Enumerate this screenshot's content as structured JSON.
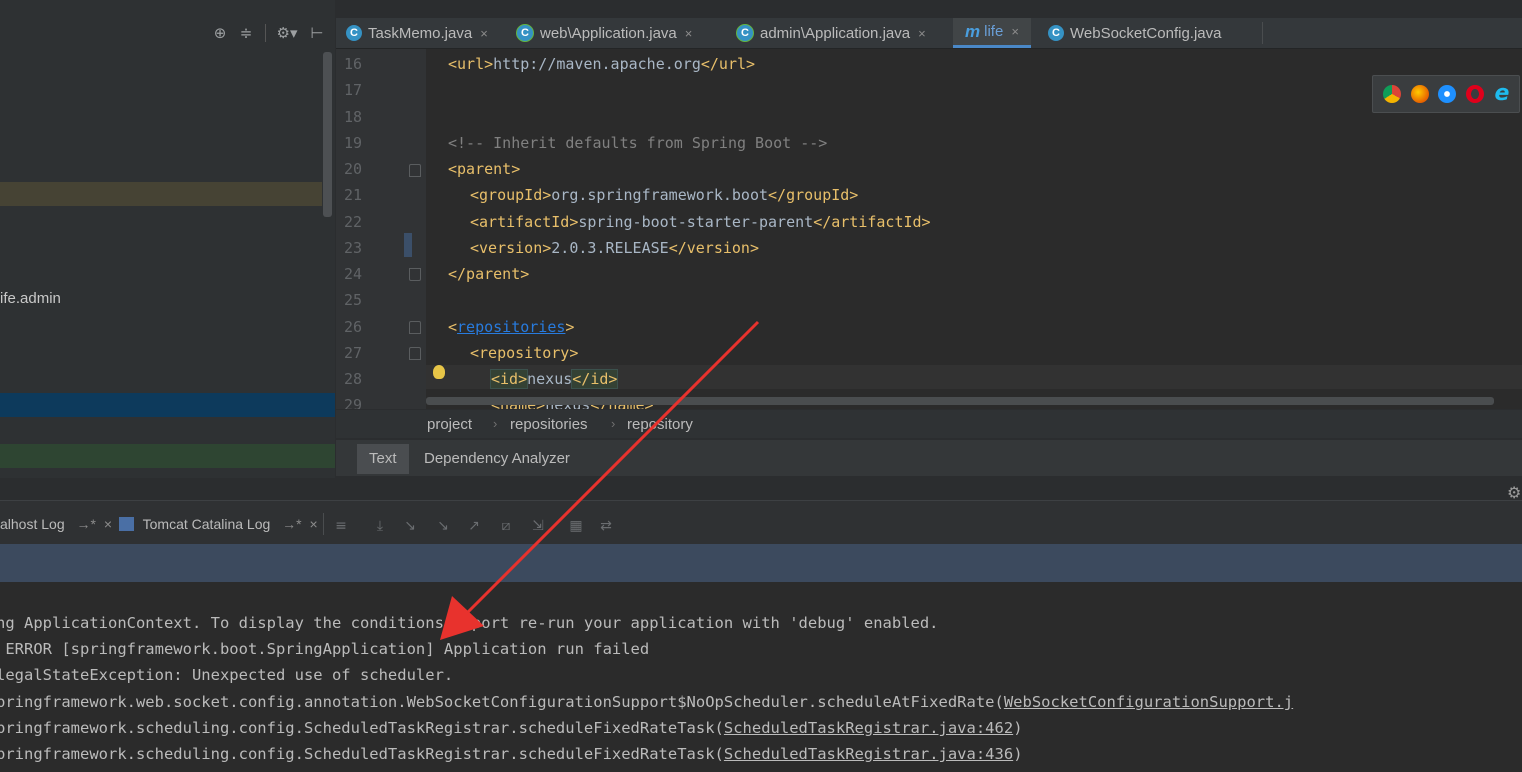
{
  "editor_tabs": [
    {
      "label": "TaskMemo.java",
      "icon": "class-icon",
      "close": "×"
    },
    {
      "label": "web\\Application.java",
      "icon": "app-class-icon",
      "close": "×"
    },
    {
      "label": "admin\\Application.java",
      "icon": "app-class-icon",
      "close": "×"
    },
    {
      "label": "life",
      "icon": "maven-icon",
      "close": "×",
      "active": true
    },
    {
      "label": "WebSocketConfig.java",
      "icon": "class-icon",
      "close": ""
    }
  ],
  "project_panel": {
    "visible_label": "ife.admin"
  },
  "code": {
    "line_numbers": [
      "16",
      "17",
      "18",
      "19",
      "20",
      "21",
      "22",
      "23",
      "24",
      "25",
      "26",
      "27",
      "28",
      "29"
    ],
    "l16_open": "<url>",
    "l16_text": "http://maven.apache.org",
    "l16_close": "</url>",
    "l19_comment": "<!-- Inherit defaults from Spring Boot -->",
    "l20_tag": "<parent>",
    "l21_open": "<groupId>",
    "l21_text": "org.springframework.boot",
    "l21_close": "</groupId>",
    "l22_open": "<artifactId>",
    "l22_text": "spring-boot-starter-parent",
    "l22_close": "</artifactId>",
    "l23_open": "<version>",
    "l23_text": "2.0.3.RELEASE",
    "l23_close": "</version>",
    "l24_tag": "</parent>",
    "l26_lt": "<",
    "l26_name": "repositories",
    "l26_gt": ">",
    "l27_tag": "<repository>",
    "l28_open": "<id>",
    "l28_text": "nexus",
    "l28_close": "</id>",
    "l29_open": "<name>",
    "l29_text": "nexus",
    "l29_close": "</name>"
  },
  "breadcrumb": [
    "project",
    "repositories",
    "repository"
  ],
  "breadcrumb_sep": "›",
  "bottom_tabs": [
    "Text",
    "Dependency Analyzer"
  ],
  "run_tabs": [
    {
      "label": "alhost Log",
      "pin": "→*",
      "close": "×"
    },
    {
      "label": "Tomcat Catalina Log",
      "pin": "→*",
      "close": "×"
    }
  ],
  "console": {
    "l1": "ng ApplicationContext. To display the conditions report re-run your application with 'debug' enabled.",
    "l2": " ERROR [springframework.boot.SpringApplication] Application run failed",
    "l3": "legalStateException: Unexpected use of scheduler.",
    "l4_pre": "pringframework.web.socket.config.annotation.WebSocketConfigurationSupport$NoOpScheduler.scheduleAtFixedRate(",
    "l4_link": "WebSocketConfigurationSupport.j",
    "l5_pre": "pringframework.scheduling.config.ScheduledTaskRegistrar.scheduleFixedRateTask(",
    "l5_link": "ScheduledTaskRegistrar.java:462",
    "l5_post": ")",
    "l6_pre": "pringframework.scheduling.config.ScheduledTaskRegistrar.scheduleFixedRateTask(",
    "l6_link": "ScheduledTaskRegistrar.java:436",
    "l6_post": ")"
  },
  "colors": {
    "tag": "#e8bf6a",
    "comment": "#808080",
    "link": "#287bde",
    "annotation_arrow": "#e8322d"
  }
}
